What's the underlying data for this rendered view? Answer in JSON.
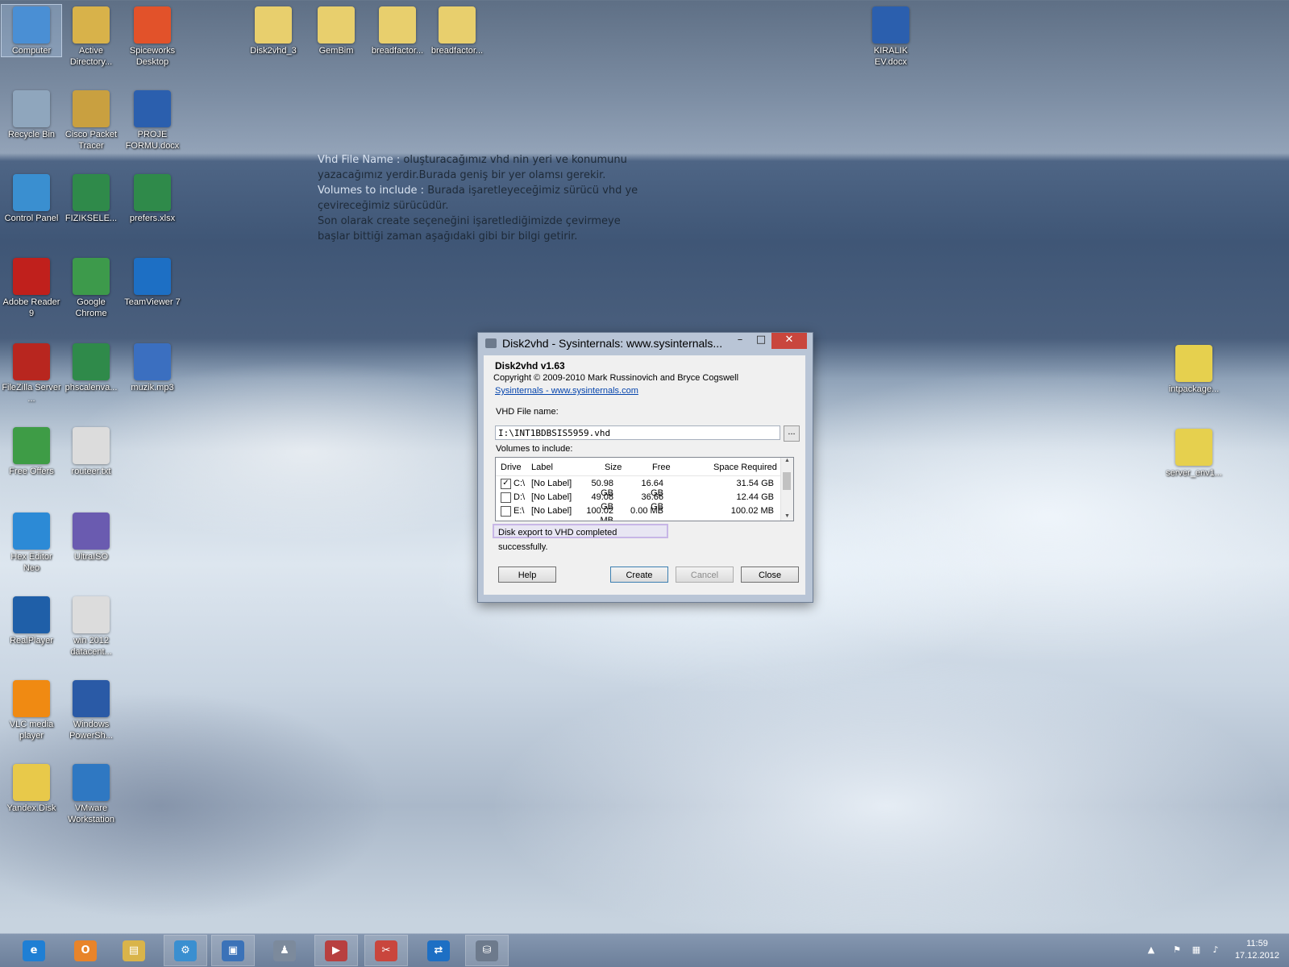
{
  "desktop_icons": [
    {
      "label": "Computer",
      "icon": "computer-icon",
      "color": "#4a8fd4"
    },
    {
      "label": "Active Directory...",
      "icon": "active-directory-icon",
      "color": "#d8b24a"
    },
    {
      "label": "Spiceworks Desktop",
      "icon": "spiceworks-icon",
      "color": "#e2522a"
    },
    {
      "label": "Disk2vhd_3",
      "icon": "folder-icon",
      "color": "#e8cf6d"
    },
    {
      "label": "GemBim",
      "icon": "folder-icon",
      "color": "#e8cf6d"
    },
    {
      "label": "breadfactor...",
      "icon": "folder-icon",
      "color": "#e8cf6d"
    },
    {
      "label": "breadfactor...",
      "icon": "zip-folder-icon",
      "color": "#e8cf6d"
    },
    {
      "label": "KIRALIK EV.docx",
      "icon": "word-document-icon",
      "color": "#2b5fae"
    },
    {
      "label": "Recycle Bin",
      "icon": "recycle-bin-icon",
      "color": "#8fa6bd"
    },
    {
      "label": "Cisco Packet Tracer",
      "icon": "cisco-packet-tracer-icon",
      "color": "#c9a040"
    },
    {
      "label": "PROJE FORMU.docx",
      "icon": "word-document-icon",
      "color": "#2b5fae"
    },
    {
      "label": "Control Panel",
      "icon": "control-panel-icon",
      "color": "#3a8fd0"
    },
    {
      "label": "FIZIKSELE...",
      "icon": "excel-document-icon",
      "color": "#2f8a4a"
    },
    {
      "label": "prefers.xlsx",
      "icon": "excel-document-icon",
      "color": "#2f8a4a"
    },
    {
      "label": "Adobe Reader 9",
      "icon": "adobe-reader-icon",
      "color": "#c0201c"
    },
    {
      "label": "Google Chrome",
      "icon": "chrome-icon",
      "color": "#3d9a4b"
    },
    {
      "label": "TeamViewer 7",
      "icon": "teamviewer-icon",
      "color": "#1d6fc4"
    },
    {
      "label": "FileZilla Server ...",
      "icon": "filezilla-icon",
      "color": "#b8261f"
    },
    {
      "label": "phscalenva...",
      "icon": "excel-document-icon",
      "color": "#2f8a4a"
    },
    {
      "label": "muzik.mp3",
      "icon": "mp3-file-icon",
      "color": "#3b6fc0"
    },
    {
      "label": "Free Offers",
      "icon": "gift-icon",
      "color": "#3e9c46"
    },
    {
      "label": "routeer.txt",
      "icon": "text-file-icon",
      "color": "#dcdcdc"
    },
    {
      "label": "Hex Editor Neo",
      "icon": "hex-editor-icon",
      "color": "#2c8ad6"
    },
    {
      "label": "UltraISO",
      "icon": "ultraiso-icon",
      "color": "#6a5bb0"
    },
    {
      "label": "RealPlayer",
      "icon": "realplayer-icon",
      "color": "#1f5fa8"
    },
    {
      "label": "win 2012 datacent...",
      "icon": "text-file-icon",
      "color": "#dcdcdc"
    },
    {
      "label": "VLC media player",
      "icon": "vlc-icon",
      "color": "#f08a12"
    },
    {
      "label": "Windows PowerSh...",
      "icon": "powershell-icon",
      "color": "#2a5aa6"
    },
    {
      "label": "Yandex.Disk",
      "icon": "yandex-disk-icon",
      "color": "#e8c94a"
    },
    {
      "label": "VMware Workstation",
      "icon": "vmware-icon",
      "color": "#2f78c2"
    },
    {
      "label": "intpackage...",
      "icon": "package-icon",
      "color": "#e6d04e"
    },
    {
      "label": "server_env1...",
      "icon": "package-icon",
      "color": "#e6d04e"
    }
  ],
  "note": {
    "line1_label": "Vhd File Name :",
    "line1_text": " oluşturacağımız vhd nin yeri ve konumunu",
    "line2": "yazacağımız yerdir.Burada geniş bir yer olamsı gerekir.",
    "line3_label": "Volumes to include :",
    "line3_text": "  Burada işaretleyeceğimiz sürücü vhd ye",
    "line4": "çevireceğimiz sürücüdür.",
    "line5": "Son olarak create seçeneğini işaretlediğimizde çevirmeye",
    "line6": "başlar bittiği zaman aşağıdaki gibi bir bilgi getirir."
  },
  "dialog": {
    "title": "Disk2vhd - Sysinternals: www.sysinternals...",
    "min_glyph": "–",
    "max_glyph": "□",
    "close_glyph": "✕",
    "app_name": "Disk2vhd v1.63",
    "copyright": "Copyright  © 2009-2010 Mark Russinovich and Bryce Cogswell",
    "link": "Sysinternals - www.sysinternals.com",
    "vhd_label": "VHD File name:",
    "vhd_value": "I:\\INT1BDBSIS5959.vhd",
    "browse": "...",
    "volumes_label": "Volumes to include:",
    "columns": [
      "Drive",
      "Label",
      "Size",
      "Free",
      "Space Required"
    ],
    "rows": [
      {
        "checked": "✓",
        "drive": "C:\\",
        "label": "[No Label]",
        "size": "50.98 GB",
        "free": "16.64 GB",
        "required": "31.54 GB"
      },
      {
        "checked": "",
        "drive": "D:\\",
        "label": "[No Label]",
        "size": "49.08 GB",
        "free": "36.66 GB",
        "required": "12.44 GB"
      },
      {
        "checked": "",
        "drive": "E:\\",
        "label": "[No Label]",
        "size": "100.02 MB",
        "free": "0.00 MB",
        "required": "100.02 MB"
      }
    ],
    "scroll_up": "▲",
    "scroll_down": "▼",
    "status": "Disk export to VHD completed successfully.",
    "buttons": {
      "help": "Help",
      "create": "Create",
      "cancel": "Cancel",
      "close": "Close"
    }
  },
  "taskbar": {
    "items": [
      {
        "icon": "internet-explorer-icon",
        "glyph": "e",
        "color": "#1f7fd4",
        "open": false
      },
      {
        "icon": "outlook-icon",
        "glyph": "O",
        "color": "#e8842a",
        "open": false
      },
      {
        "icon": "file-explorer-icon",
        "glyph": "▤",
        "color": "#d9b44a",
        "open": false
      },
      {
        "icon": "control-panel-icon",
        "glyph": "⚙",
        "color": "#3a8fd0",
        "open": true
      },
      {
        "icon": "remote-desktop-icon",
        "glyph": "▣",
        "color": "#3b72b8",
        "open": true
      },
      {
        "icon": "wizard-icon",
        "glyph": "♟",
        "color": "#7c8a9c",
        "open": false
      },
      {
        "icon": "media-icon",
        "glyph": "▶",
        "color": "#b84040",
        "open": true
      },
      {
        "icon": "snipping-tool-icon",
        "glyph": "✂",
        "color": "#c9463d",
        "open": true
      },
      {
        "icon": "teamviewer-icon",
        "glyph": "⇄",
        "color": "#1d6fc4",
        "open": false
      },
      {
        "icon": "disk2vhd-icon",
        "glyph": "⛁",
        "color": "#6d7a8c",
        "open": true
      }
    ],
    "time": "11:59",
    "date": "17.12.2012"
  },
  "colors": {
    "accent": "#3c7fb1",
    "close_red": "#c9463d",
    "status_border": "#c7b6e6"
  }
}
